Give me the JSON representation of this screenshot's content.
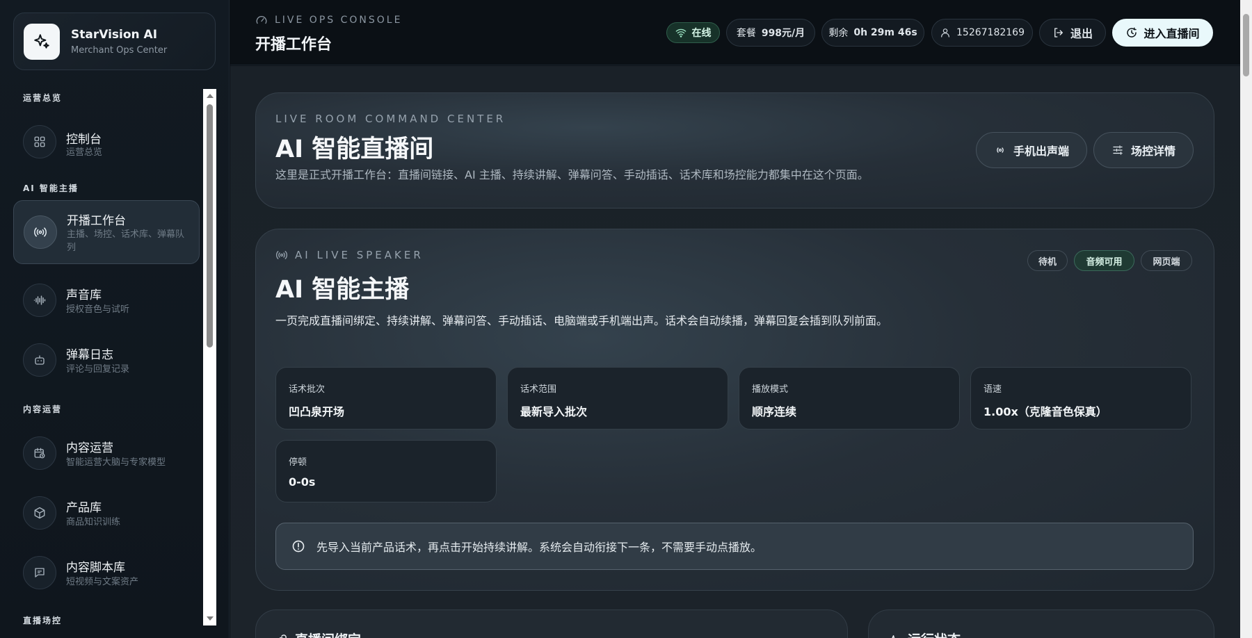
{
  "brand": {
    "title": "StarVision AI",
    "subtitle": "Merchant Ops Center",
    "icon": "sparkle-icon"
  },
  "sidebar": {
    "sections": [
      {
        "title": "运营总览"
      },
      {
        "title": "AI 智能主播"
      },
      {
        "title": "内容运营"
      },
      {
        "title": "直播场控"
      }
    ],
    "items": [
      {
        "label": "控制台",
        "desc": "运营总览",
        "icon": "grid-icon"
      },
      {
        "label": "开播工作台",
        "desc": "主播、场控、话术库、弹幕队列",
        "icon": "broadcast-icon",
        "active": true
      },
      {
        "label": "声音库",
        "desc": "授权音色与试听",
        "icon": "waveform-icon"
      },
      {
        "label": "弹幕日志",
        "desc": "评论与回复记录",
        "icon": "bot-icon"
      },
      {
        "label": "内容运营",
        "desc": "智能运营大脑与专家模型",
        "icon": "calendar-clock-icon"
      },
      {
        "label": "产品库",
        "desc": "商品知识训练",
        "icon": "box-icon"
      },
      {
        "label": "内容脚本库",
        "desc": "短视频与文案资产",
        "icon": "message-icon"
      }
    ]
  },
  "header": {
    "kicker": "LIVE OPS CONSOLE",
    "title": "开播工作台",
    "status": "在线",
    "plan_label": "套餐",
    "plan_value": "998元/月",
    "remain_label": "剩余",
    "remain_value": "0h 29m 46s",
    "phone": "15267182169",
    "logout": "退出",
    "enter_live": "进入直播间"
  },
  "hero": {
    "kicker": "LIVE ROOM COMMAND CENTER",
    "title": "AI 智能直播间",
    "desc": "这里是正式开播工作台：直播间链接、AI 主播、持续讲解、弹幕问答、手动插话、话术库和场控能力都集中在这个页面。",
    "btn_phone": "手机出声端",
    "btn_control": "场控详情"
  },
  "speaker": {
    "kicker": "AI LIVE SPEAKER",
    "title": "AI 智能主播",
    "desc": "一页完成直播间绑定、持续讲解、弹幕问答、手动插话、电脑端或手机端出声。话术会自动续播，弹幕回复会插到队列前面。",
    "tags": [
      "待机",
      "音频可用",
      "网页端"
    ],
    "stats": [
      {
        "k": "话术批次",
        "v": "凹凸泉开场"
      },
      {
        "k": "话术范围",
        "v": "最新导入批次"
      },
      {
        "k": "播放模式",
        "v": "顺序连续"
      },
      {
        "k": "语速",
        "v": "1.00x（克隆音色保真）"
      },
      {
        "k": "停顿",
        "v": "0-0s"
      }
    ],
    "notice": "先导入当前产品话术，再点击开始持续讲解。系统会自动衔接下一条，不需要手动点播放。"
  },
  "bottom": {
    "bind_title": "直播间绑定",
    "status_title": "运行状态"
  }
}
